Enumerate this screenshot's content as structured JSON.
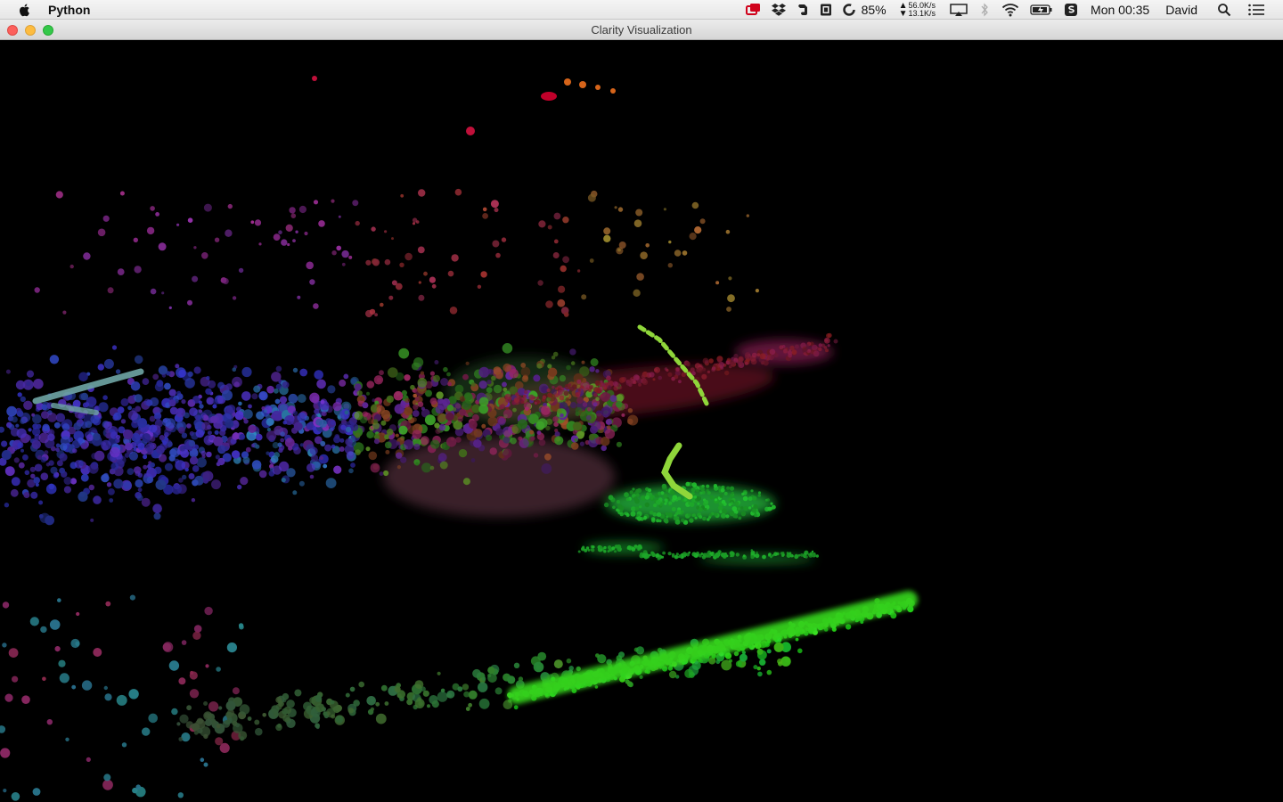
{
  "menubar": {
    "app_name": "Python",
    "battery_percent": "85%",
    "net_up": "56.0K/s",
    "net_down": "13.1K/s",
    "clock": "Mon 00:35",
    "user": "David"
  },
  "window": {
    "title": "Clarity Visualization"
  },
  "colors": {
    "background": "#000000",
    "close": "#fc605c",
    "minimize": "#fdbc40",
    "maximize": "#34c84a"
  }
}
